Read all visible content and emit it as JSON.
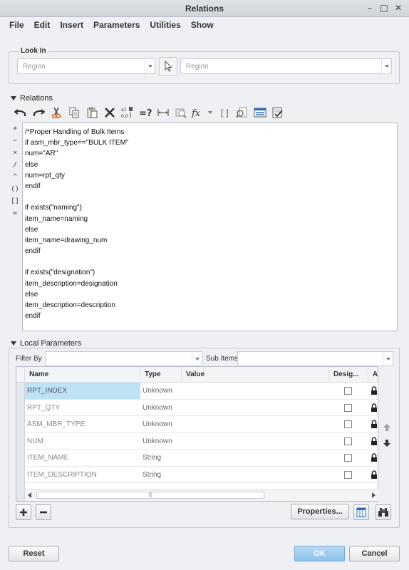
{
  "window": {
    "title": "Relations"
  },
  "menu": [
    "File",
    "Edit",
    "Insert",
    "Parameters",
    "Utilities",
    "Show"
  ],
  "look_in": {
    "label": "Look In",
    "type_value": "Region",
    "item_value": "Region"
  },
  "relations": {
    "label": "Relations",
    "operators": [
      "+",
      "−",
      "×",
      "/",
      "^",
      "()",
      "[]",
      "="
    ],
    "lines": [
      "/*Proper Handling of Bulk Items",
      "if asm_mbr_type==\"BULK ITEM\"",
      "num=\"AR\"",
      "else",
      "num=rpt_qty",
      "endif",
      "",
      "if exists(\"naming\")",
      "item_name=naming",
      "else",
      "item_name=drawing_num",
      "endif",
      "",
      "if exists(\"designation\")",
      "item_description=designation",
      "else",
      "item_description=description",
      "endif"
    ]
  },
  "local_parameters": {
    "label": "Local Parameters",
    "filter_by_label": "Filter By",
    "filter_by_value": "",
    "sub_items_label": "Sub Items",
    "sub_items_value": "",
    "columns": {
      "name": "Name",
      "type": "Type",
      "value": "Value",
      "designate": "Desig...",
      "access": "A"
    },
    "rows": [
      {
        "name": "RPT_INDEX",
        "type": "Unknown",
        "value": ""
      },
      {
        "name": "RPT_QTY",
        "type": "Unknown",
        "value": ""
      },
      {
        "name": "ASM_MBR_TYPE",
        "type": "Unknown",
        "value": ""
      },
      {
        "name": "NUM",
        "type": "Unknown",
        "value": ""
      },
      {
        "name": "ITEM_NAME",
        "type": "String",
        "value": ""
      },
      {
        "name": "ITEM_DESCRIPTION",
        "type": "String",
        "value": ""
      }
    ],
    "scroll_grip": "|||",
    "properties_label": "Properties..."
  },
  "footer": {
    "reset_label": "Reset",
    "ok_label": "OK",
    "cancel_label": "Cancel"
  },
  "colors": {
    "selection": "#bfe3f6",
    "ok_button": "#8cc3ec",
    "accent_blue": "#2b6cb8"
  }
}
